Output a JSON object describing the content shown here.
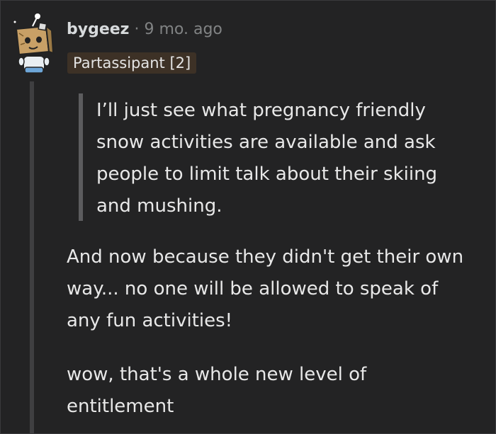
{
  "comment": {
    "username": "bygeez",
    "separator": "·",
    "timestamp": "9 mo. ago",
    "flair": "Partassipant [2]",
    "quote": "I’ll just see what pregnancy friendly snow activities are available and ask people to limit talk about their skiing and mushing.",
    "paragraphs": [
      "And now because they didn't get their own way... no one will be allowed to speak of any fun activities!",
      "wow, that's a whole new level of entitlement"
    ]
  },
  "avatar": {
    "icon": "snoo-box-avatar-icon"
  },
  "colors": {
    "background": "#232324",
    "text": "#e8e8e8",
    "meta": "#818384",
    "flair_bg": "#3d3126",
    "quote_bar": "#5c5c5e"
  }
}
